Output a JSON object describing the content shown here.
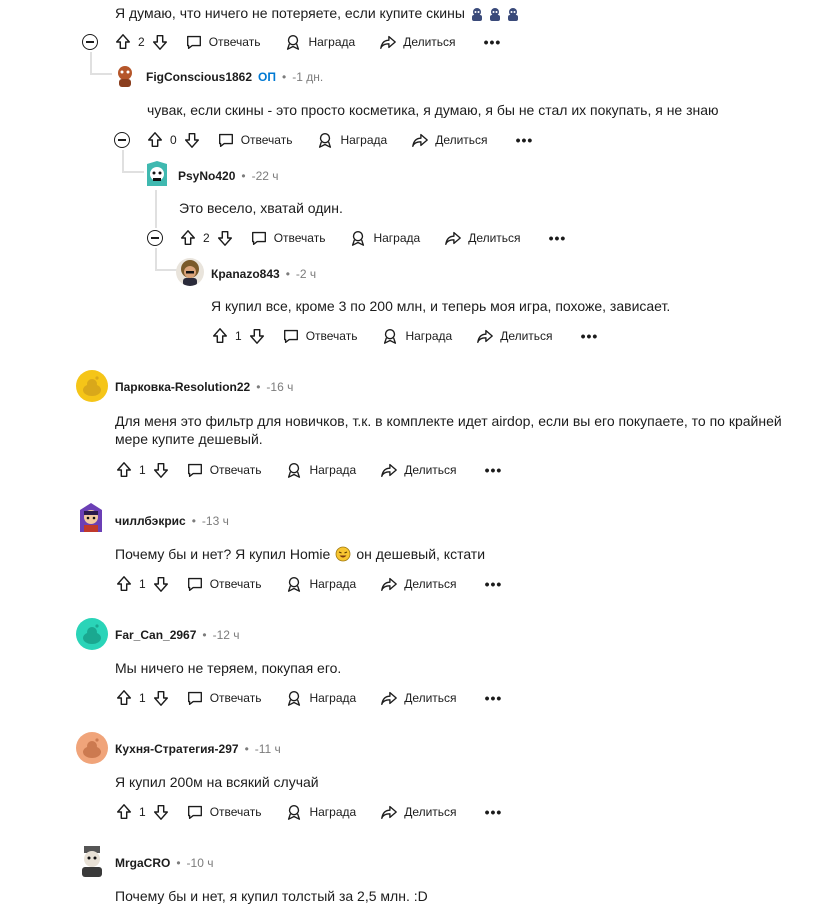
{
  "labels": {
    "reply": "Отвечать",
    "award": "Награда",
    "share": "Делиться",
    "more": "•••",
    "dot": "•"
  },
  "comments": [
    {
      "text": "Я думаю, что ничего не потеряете, если купите скины",
      "votes": "2"
    },
    {
      "user": "FigConscious1862",
      "op": "ОП",
      "time": "-1 дн.",
      "text": "чувак, если скины - это просто косметика, я думаю, я бы не стал их покупать, я не знаю",
      "votes": "0"
    },
    {
      "user": "PsyNo420",
      "time": "-22 ч",
      "text": "Это весело, хватай один.",
      "votes": "2"
    },
    {
      "user": "Кpanazo843",
      "time": "-2 ч",
      "text": "Я купил все, кроме 3 по 200 млн, и теперь моя игра, похоже, зависает.",
      "votes": "1"
    },
    {
      "user": "Парковка-Resolution22",
      "time": "-16 ч",
      "text": "Для меня это фильтр для новичков, т.к. в комплекте идет airdop, если вы его покупаете, то по крайней мере купите дешевый.",
      "votes": "1"
    },
    {
      "user": "чиллбэкрис",
      "time": "-13 ч",
      "text": "Почему бы и нет? Я купил Homie",
      "text_after": "он дешевый, кстати",
      "votes": "1"
    },
    {
      "user": "Far_Can_2967",
      "time": "-12 ч",
      "text": "Мы ничего не теряем, покупая его.",
      "votes": "1"
    },
    {
      "user": "Кухня-Стратегия-297",
      "time": "-11 ч",
      "text": "Я купил 200м на всякий случай",
      "votes": "1"
    },
    {
      "user": "MrgaCRO",
      "time": "-10 ч",
      "text": "Почему бы и нет, я купил толстый за 2,5 млн. :D"
    }
  ],
  "colors": {
    "avatar_yellow": "#f5c518",
    "avatar_teal": "#2ad4b8",
    "avatar_peach": "#f0a47a",
    "op_blue": "#0079d3"
  }
}
